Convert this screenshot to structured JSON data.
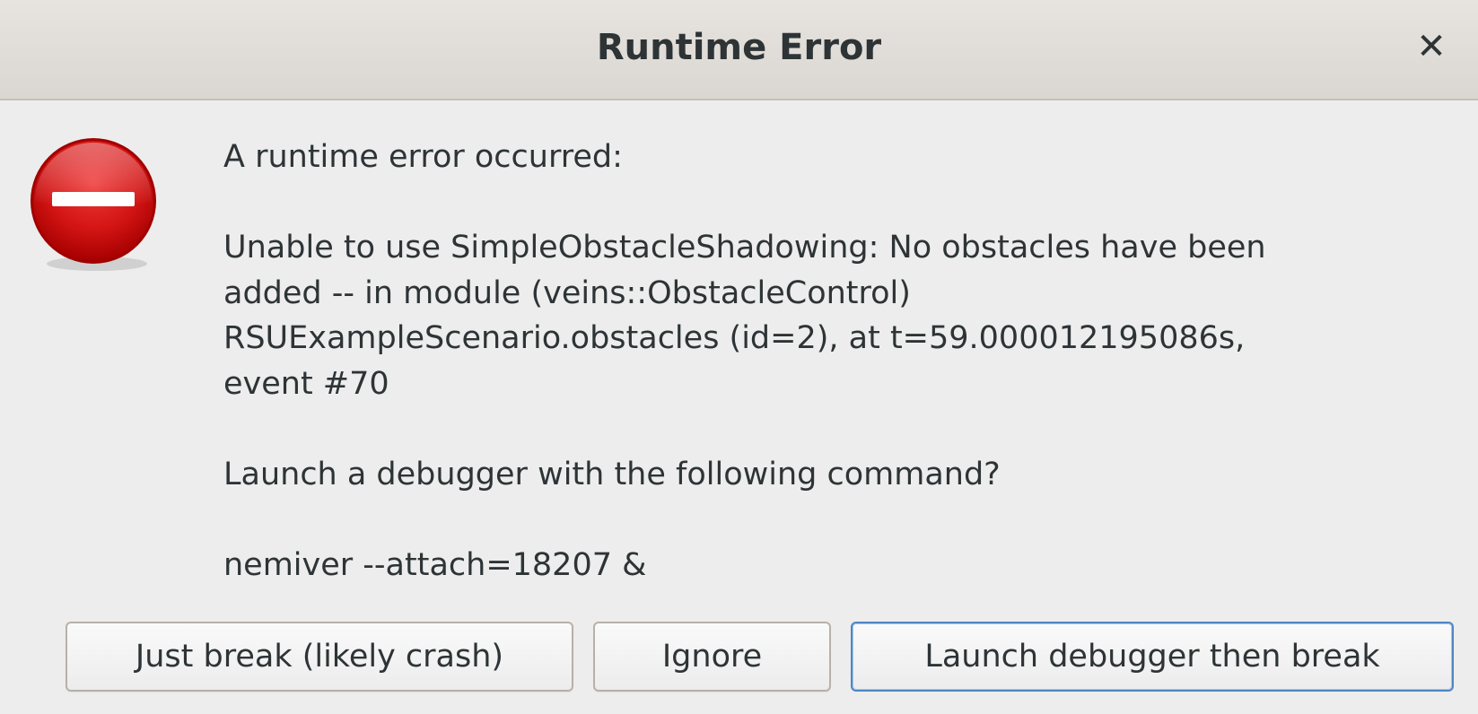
{
  "dialog": {
    "title": "Runtime Error",
    "close_glyph": "✕",
    "icon": "dialog-error-icon",
    "message": {
      "intro": "A runtime error occurred:",
      "error_lines": [
        "Unable to use SimpleObstacleShadowing: No obstacles have been",
        "added -- in module (veins::ObstacleControl)",
        "RSUExampleScenario.obstacles (id=2), at t=59.000012195086s,",
        "event #70"
      ],
      "question": "Launch a debugger with the following command?",
      "command": "nemiver --attach=18207 &"
    },
    "buttons": {
      "just_break": "Just break (likely crash)",
      "ignore": "Ignore",
      "launch_debugger": "Launch debugger then break"
    }
  },
  "colors": {
    "error_red": "#cc0000",
    "title_bg": "#dad6d1",
    "dialog_bg": "#ededed",
    "default_button_border": "#4f86c6"
  }
}
